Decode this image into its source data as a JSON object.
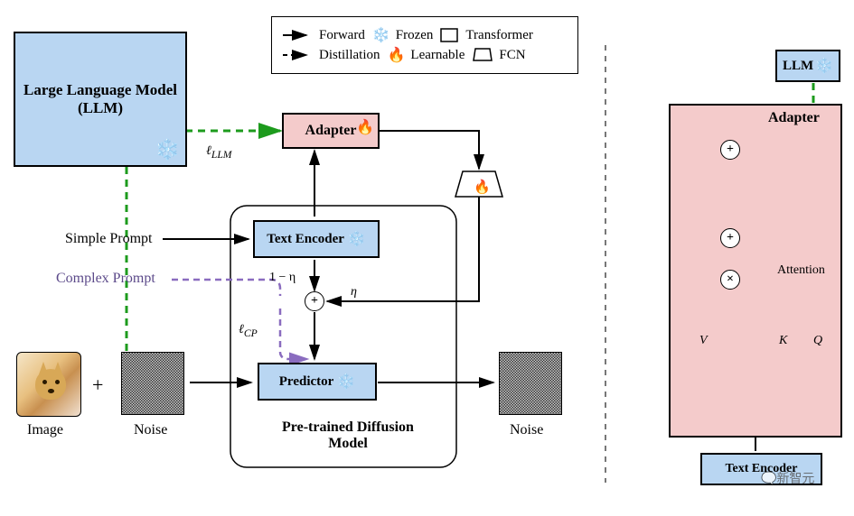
{
  "legend": {
    "forward": "Forward",
    "distillation": "Distillation",
    "frozen": "Frozen",
    "learnable": "Learnable",
    "transformer": "Transformer",
    "fcn": "FCN"
  },
  "left": {
    "llm_title": "Large Language Model (LLM)",
    "adapter": "Adapter",
    "text_encoder": "Text Encoder",
    "predictor": "Predictor",
    "diffusion_model": "Pre-trained Diffusion Model",
    "simple_prompt": "Simple Prompt",
    "complex_prompt": "Complex Prompt",
    "image": "Image",
    "noise": "Noise",
    "noise2": "Noise",
    "loss_llm": "ℓ",
    "loss_llm_sub": "LLM",
    "loss_cp": "ℓ",
    "loss_cp_sub": "CP",
    "eta": "η",
    "one_minus_eta": "1 − η"
  },
  "right": {
    "llm": "LLM",
    "adapter": "Adapter",
    "text_encoder": "Text Encoder",
    "attention": "Attention",
    "V": "V",
    "K": "K",
    "Q": "Q"
  },
  "watermark": "新智元"
}
